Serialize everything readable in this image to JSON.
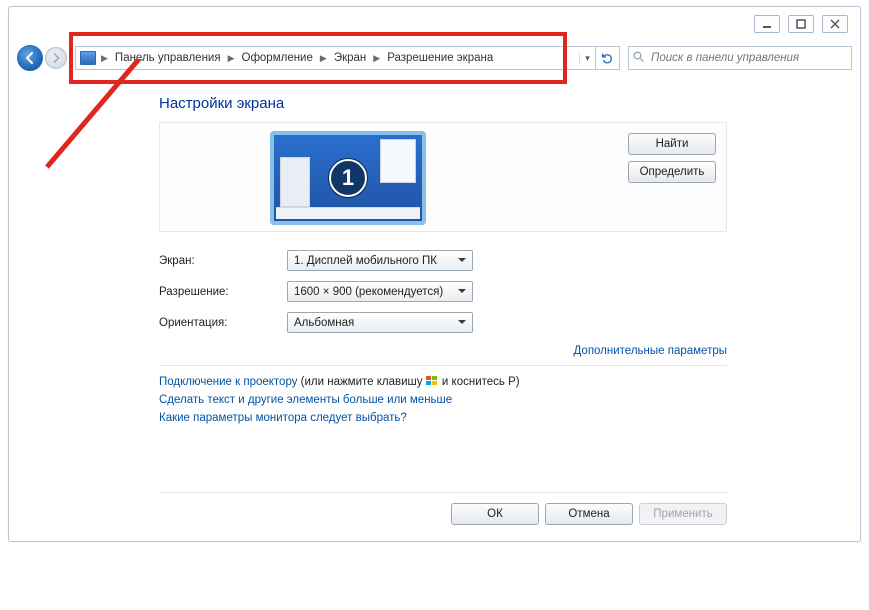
{
  "window_buttons": {
    "minimize": "—",
    "maximize": "□",
    "close": "✕"
  },
  "breadcrumb": {
    "items": [
      "Панель управления",
      "Оформление",
      "Экран",
      "Разрешение экрана"
    ]
  },
  "search": {
    "placeholder": "Поиск в панели управления"
  },
  "page": {
    "title": "Настройки экрана",
    "monitor_number": "1",
    "buttons": {
      "find": "Найти",
      "identify": "Определить"
    },
    "fields": {
      "screen_label": "Экран:",
      "screen_value": "1. Дисплей мобильного ПК",
      "resolution_label": "Разрешение:",
      "resolution_value": "1600 × 900 (рекомендуется)",
      "orientation_label": "Ориентация:",
      "orientation_value": "Альбомная"
    },
    "advanced_link": "Дополнительные параметры",
    "projector_link_a": "Подключение к проектору",
    "projector_tail": " (или нажмите клавишу ",
    "projector_tail2": " и коснитесь P)",
    "link2": "Сделать текст и другие элементы больше или меньше",
    "link3": "Какие параметры монитора следует выбрать?",
    "footer": {
      "ok": "ОК",
      "cancel": "Отмена",
      "apply": "Применить"
    }
  }
}
